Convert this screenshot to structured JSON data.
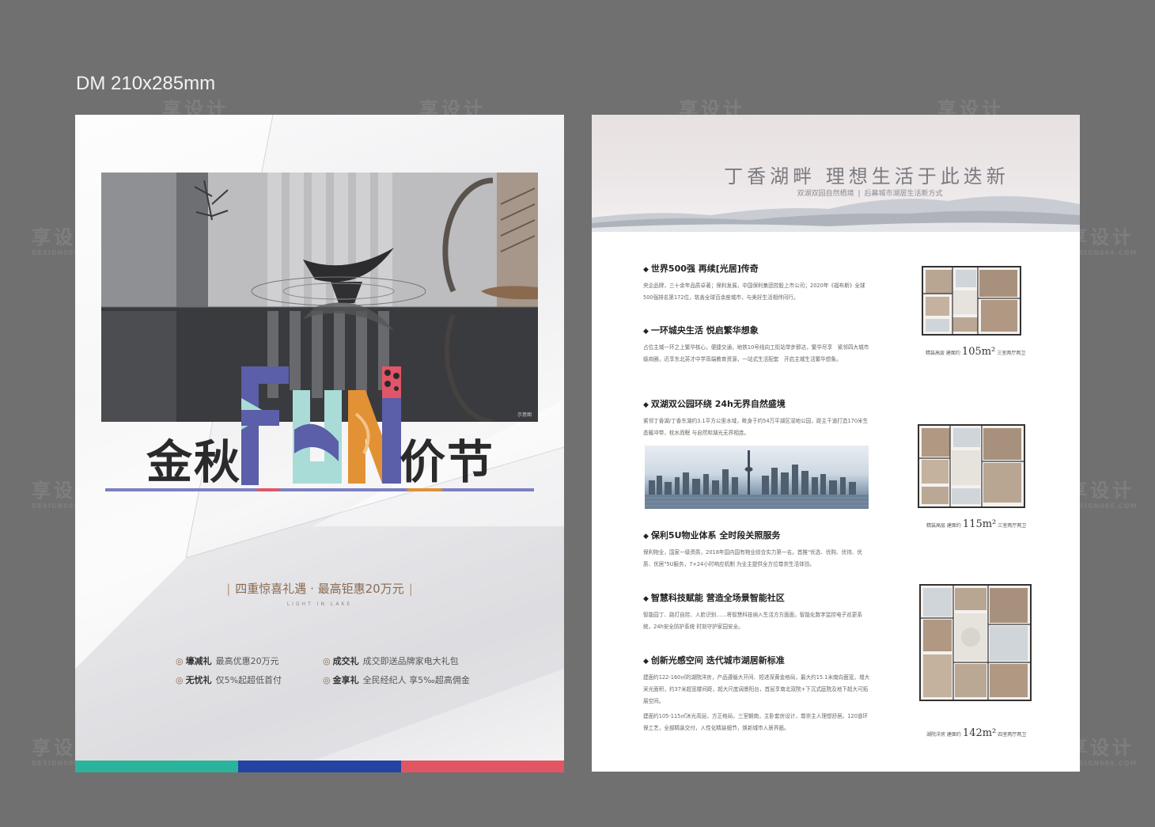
{
  "label": "DM 210x285mm",
  "watermark": {
    "text": "享设计",
    "sub": "DESIGN006.COM"
  },
  "left": {
    "title_part1": "金秋",
    "fun_text": "FUN",
    "title_part2": "价节",
    "hero_caption": "示意图",
    "promo": "四重惊喜礼遇 · 最高钜惠20万元",
    "promo_sub": "LIGHT IN LAKE",
    "gifts": [
      {
        "name": "壕减礼",
        "desc": "最高优惠20万元"
      },
      {
        "name": "成交礼",
        "desc": "成交即送品牌家电大礼包"
      },
      {
        "name": "无忧礼",
        "desc": "仅5%起超低首付"
      },
      {
        "name": "金享礼",
        "desc": "全民经纪人 享5‰超高佣金"
      }
    ],
    "bottom_colors": [
      "#2bb39c",
      "#2344a0",
      "#e25563"
    ]
  },
  "right": {
    "title": "丁香湖畔  理想生活于此迭新",
    "subtitle_1": "双湖双园自然栖境",
    "subtitle_2": "后幕城市湖居生活新方式",
    "sections": [
      {
        "heading": "世界500强 再续[光居]传奇",
        "body": "央企品牌，三十余年品质卓著；保利发展，中国保利集团控股上市公司；2020年《福布斯》全球500强排名第172位，筑善全球百余座城市，与美好生活相伴同行。"
      },
      {
        "heading": "一环城央生活 悦启繁华想象",
        "body": "占位主城一环之上繁华核心，便捷交通，地铁10号线向工街站举步即达，繁华尽享　紧邻四大城市级商圈，近享东北英才中学高端教育资源，一站式生活配套　开启主城生活繁华想象。"
      },
      {
        "heading": "双湖双公园环绕  24h无界自然盛境",
        "body": "紧邻丁香湖/丁香东湖约3.1平方公里水域，毗身于约54万平湖区湿地公园，距主干道打造170米生态暖冲带，枕水而眠 与自然和湖光无界相连。"
      },
      {
        "heading": "保利5U物业体系  全时段关照服务",
        "body": "保利物业，国家一级资质，2018年国内国有物业综合实力第一名。首推\"优选、优购、优待、优质、优居\"5U服务，7×24小时响应机制 为业主提供全方位尊崇生活体验。"
      },
      {
        "heading": "智慧科技赋能  营造全场景智能社区",
        "body": "智能园丁、路灯自控、人脸识别……将智慧科技纳入生活方方面面，智能化数字监控电子巡更系统，24h安全防护系统 时刻守护家园安全。"
      },
      {
        "heading": "创新光感空间  迭代城市湖居新标准",
        "body": "建面约122-160㎡的湖院洋房，产品遵循大开间、短进深黄金格局，最大约15.1米南向面宽，增大采光面积，约37米超宽楼间距，超大尺度阔景阳台，首层享南北双院+下沉式庭院及地下超大可拓展空间。",
        "body2": "建面约105-115㎡沐光高层，方正格局，三室朝南，主卧套房设计，尊崇主人理想舒居。120道环保工艺，全部精装交付，人性化精装细节，焕新城市人居界面。"
      }
    ],
    "plans": [
      {
        "prefix": "精装高层 建面约",
        "area": "105m²",
        "layout": "三室两厅两卫"
      },
      {
        "prefix": "精装高层 建面约",
        "area": "115m²",
        "layout": "三室两厅两卫"
      },
      {
        "prefix": "湖院洋房 建面约",
        "area": "142m²",
        "layout": "四室两厅两卫"
      }
    ]
  }
}
